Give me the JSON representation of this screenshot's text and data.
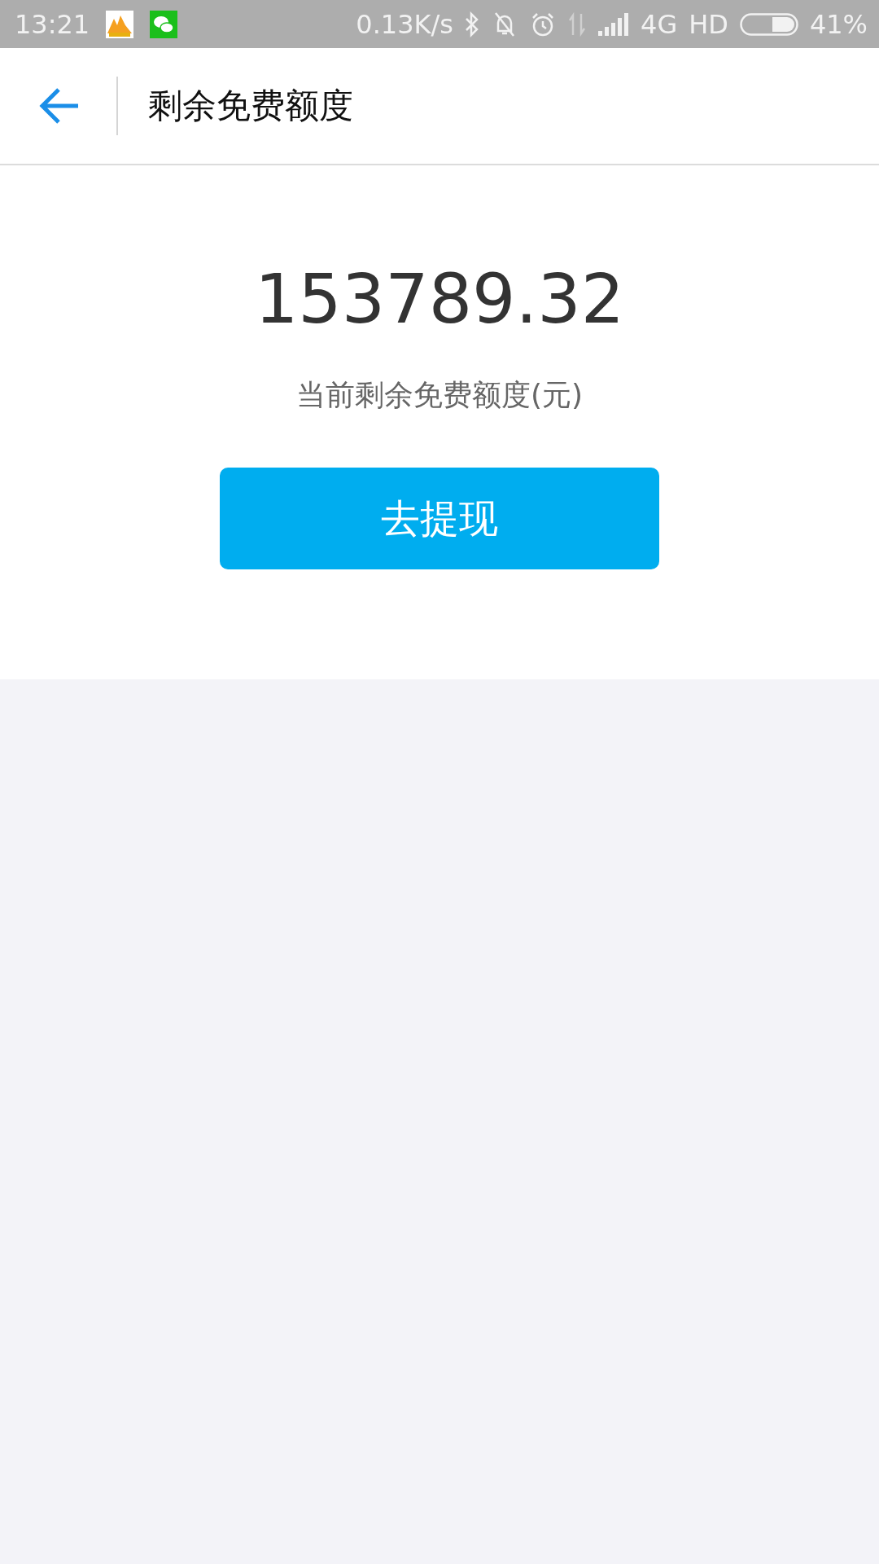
{
  "status_bar": {
    "time": "13:21",
    "speed": "0.13K/s",
    "network": "4G",
    "hd": "HD",
    "battery": "41%"
  },
  "header": {
    "title": "剩余免费额度"
  },
  "balance": {
    "amount": "153789.32",
    "caption": "当前剩余免费额度(元)"
  },
  "withdraw_button": {
    "label": "去提现"
  }
}
